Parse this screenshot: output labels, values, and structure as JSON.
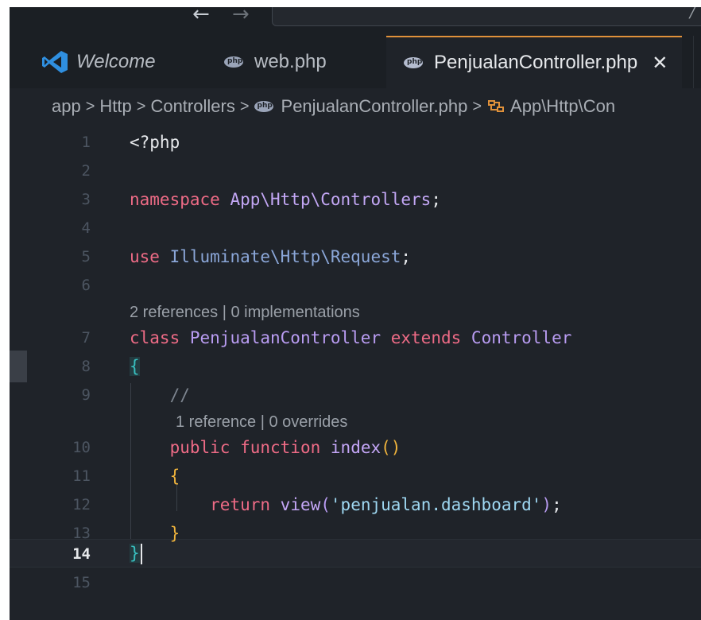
{
  "titlebar": {
    "back_glyph": "←",
    "forward_glyph": "→",
    "cmd_close_glyph": "╱"
  },
  "tabs": [
    {
      "label": "Welcome",
      "icon": "vscode-icon"
    },
    {
      "label": "web.php",
      "icon": "php-file-icon"
    },
    {
      "label": "PenjualanController.php",
      "icon": "php-file-icon",
      "active": true,
      "close": "✕"
    }
  ],
  "breadcrumb": {
    "items": [
      "app",
      "Http",
      "Controllers",
      "PenjualanController.php",
      "App\\Http\\Con"
    ],
    "separator": ">"
  },
  "editor": {
    "active_line": "14",
    "code_lens": {
      "class": "2 references | 0 implementations",
      "method": "1 reference | 0 overrides"
    },
    "lines": [
      {
        "num": "1",
        "text": "<?php"
      },
      {
        "num": "2",
        "text": ""
      },
      {
        "num": "3",
        "kw": "namespace",
        "ns": "App\\Http\\Controllers",
        "end": ";"
      },
      {
        "num": "4",
        "text": ""
      },
      {
        "num": "5",
        "kw": "use",
        "ns": "Illuminate\\Http\\Request",
        "end": ";"
      },
      {
        "num": "6",
        "text": ""
      },
      {
        "num": "7",
        "kw": "class",
        "cls": "PenjualanController",
        "kw2": "extends",
        "cls2": "Controller"
      },
      {
        "num": "8",
        "brace": "{"
      },
      {
        "num": "9",
        "comment": "//"
      },
      {
        "num": "10",
        "kw": "public",
        "kw2": "function",
        "fn": "index",
        "paren": "()"
      },
      {
        "num": "11",
        "brace": "{"
      },
      {
        "num": "12",
        "kw": "return",
        "fn": "view",
        "open": "(",
        "str": "'penjualan.dashboard'",
        "close": ")",
        "end": ";"
      },
      {
        "num": "13",
        "brace": "}"
      },
      {
        "num": "14",
        "brace": "}"
      },
      {
        "num": "15",
        "text": ""
      }
    ]
  },
  "colors": {
    "background": "#1f2329",
    "tab_active_border": "#e0913a",
    "keyword": "#ee6b86",
    "class_name": "#b99cf2",
    "string": "#9fd8f2",
    "brace_yellow": "#f0b43c",
    "brace_teal": "#38c0c0"
  }
}
